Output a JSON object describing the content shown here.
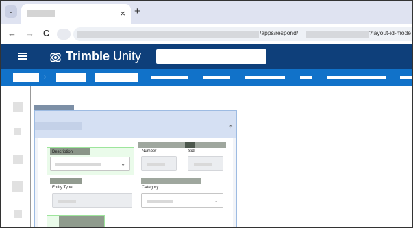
{
  "browser": {
    "tab_close_glyph": "×",
    "new_tab_glyph": "+",
    "tab_menu_glyph": "⌄",
    "back_glyph": "←",
    "forward_glyph": "→",
    "reload_glyph": "C",
    "site_info_glyph": "⚌",
    "url_segment_1": "/apps/respond/",
    "url_segment_2": "?layout-id-mode"
  },
  "app": {
    "logo_text_bold": "Trimble",
    "logo_text_light": " Unity",
    "logo_dot": ".",
    "breadcrumb_separator": "›"
  },
  "panel": {
    "pin_glyph": "⇡"
  },
  "form": {
    "description_label": "Description",
    "number_label": "Number",
    "sid_label": "Sid",
    "entity_type_label": "Entity Type",
    "category_label": "Category",
    "chevron_glyph": "⌄"
  },
  "colors": {
    "app_header": "#0e3f7a",
    "breadcrumb_band": "#1172c9",
    "tab_strip": "#dfe3f1",
    "panel_header": "#d5e0f3",
    "focus_highlight": "#9ee59c"
  }
}
